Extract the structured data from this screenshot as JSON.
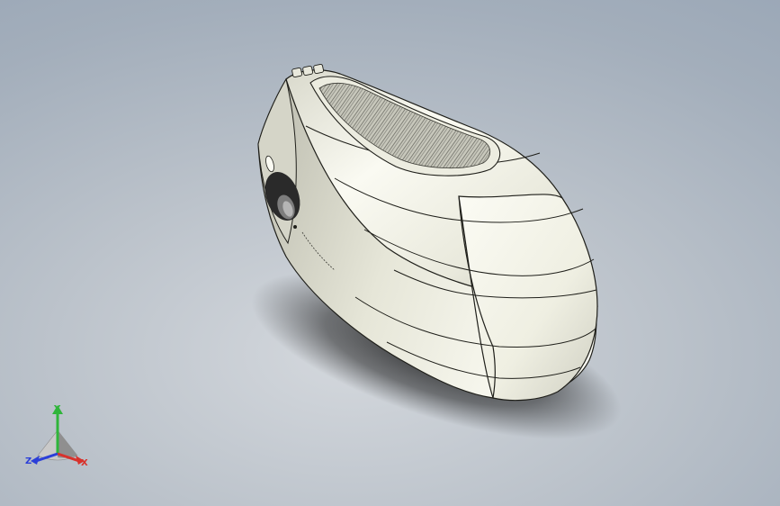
{
  "triad": {
    "x_label": "X",
    "y_label": "Y",
    "z_label": "Z",
    "x_color": "#d8322c",
    "y_color": "#2fb53a",
    "z_color": "#2b3fd8"
  },
  "model": {
    "body_color": "#f3f3e6",
    "edge_color": "#1f1f1a",
    "grip_color": "#9a9a90",
    "wheel_color": "#2a2a2a"
  }
}
